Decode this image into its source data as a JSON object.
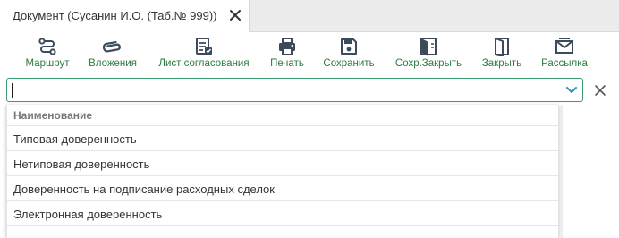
{
  "tab": {
    "title": "Документ (Сусанин И.О. (Таб.№ 999))"
  },
  "toolbar": {
    "buttons": [
      {
        "label": "Маршрут",
        "icon": "route-icon"
      },
      {
        "label": "Вложения",
        "icon": "paperclip-icon"
      },
      {
        "label": "Лист согласования",
        "icon": "approval-sheet-icon"
      },
      {
        "label": "Печать",
        "icon": "printer-icon"
      },
      {
        "label": "Сохранить",
        "icon": "save-icon"
      },
      {
        "label": "Сохр.Закрыть",
        "icon": "save-close-icon"
      },
      {
        "label": "Закрыть",
        "icon": "close-door-icon"
      },
      {
        "label": "Рассылка",
        "icon": "mail-icon"
      }
    ]
  },
  "combo": {
    "value": "",
    "placeholder": ""
  },
  "dropdown": {
    "header": "Наименование",
    "items": [
      "Типовая доверенность",
      "Нетиповая доверенность",
      "Доверенность на подписание расходных сделок",
      "Электронная доверенность"
    ]
  },
  "colors": {
    "accent": "#2f7a3f",
    "focus_border": "#3a9c6e",
    "icon": "#3c4a5a"
  }
}
